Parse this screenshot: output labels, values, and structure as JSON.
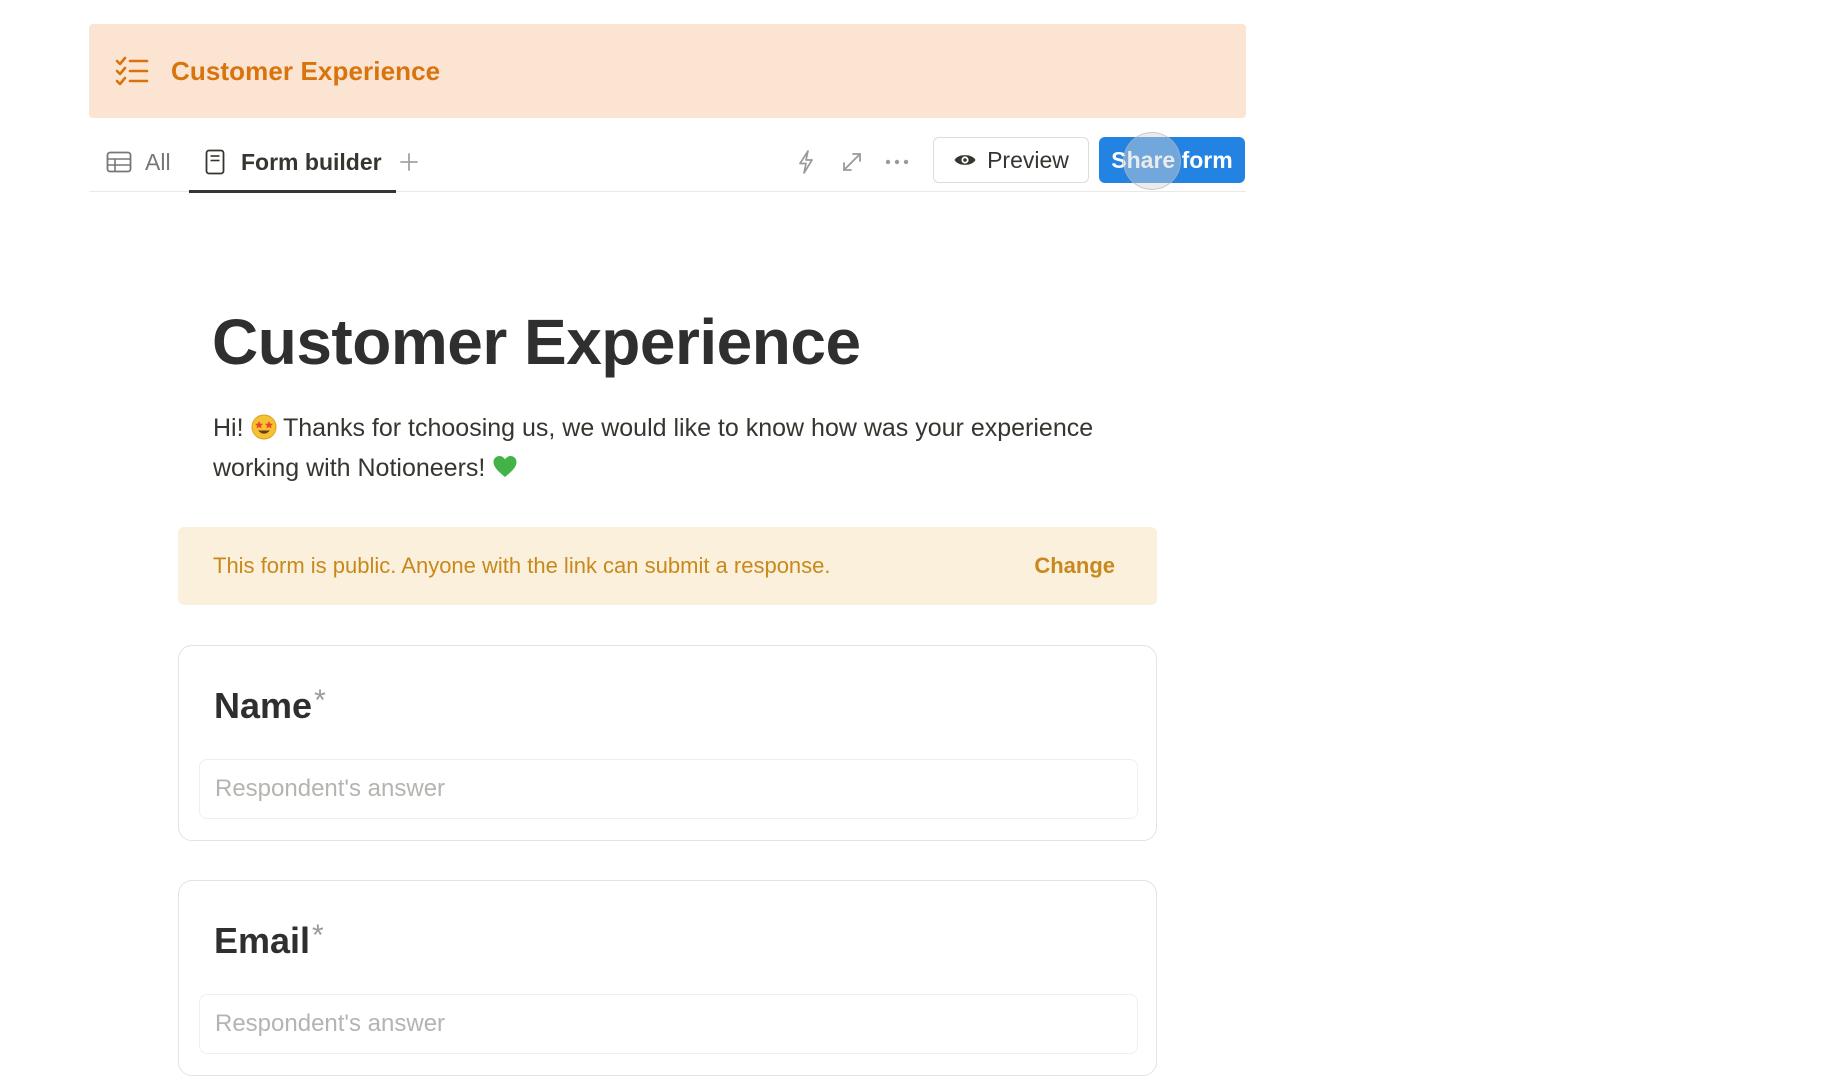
{
  "header": {
    "title": "Customer Experience",
    "icon": "checklist-icon",
    "accent_color": "#d9730d",
    "background_color": "#fbe4d1"
  },
  "views": {
    "tabs": [
      {
        "label": "All",
        "icon": "table-icon",
        "active": false
      },
      {
        "label": "Form builder",
        "icon": "form-icon",
        "active": true
      }
    ],
    "add_view_icon": "plus-icon"
  },
  "toolbar": {
    "automation_icon": "bolt-icon",
    "fullscreen_icon": "expand-icon",
    "more_icon": "more-icon",
    "preview_label": "Preview",
    "share_label": "Share form",
    "share_color": "#2383e2"
  },
  "form": {
    "title": "Customer Experience",
    "description_part1": "Hi! ",
    "description_part2": " Thanks for tchoosing us, we would like to know how was your experience working with Notioneers! ",
    "notice_text": "This form is public. Anyone with the link can submit a response.",
    "notice_action": "Change",
    "fields": [
      {
        "label": "Name",
        "required_mark": "*",
        "placeholder": "Respondent's answer"
      },
      {
        "label": "Email",
        "required_mark": "*",
        "placeholder": "Respondent's answer"
      }
    ]
  }
}
